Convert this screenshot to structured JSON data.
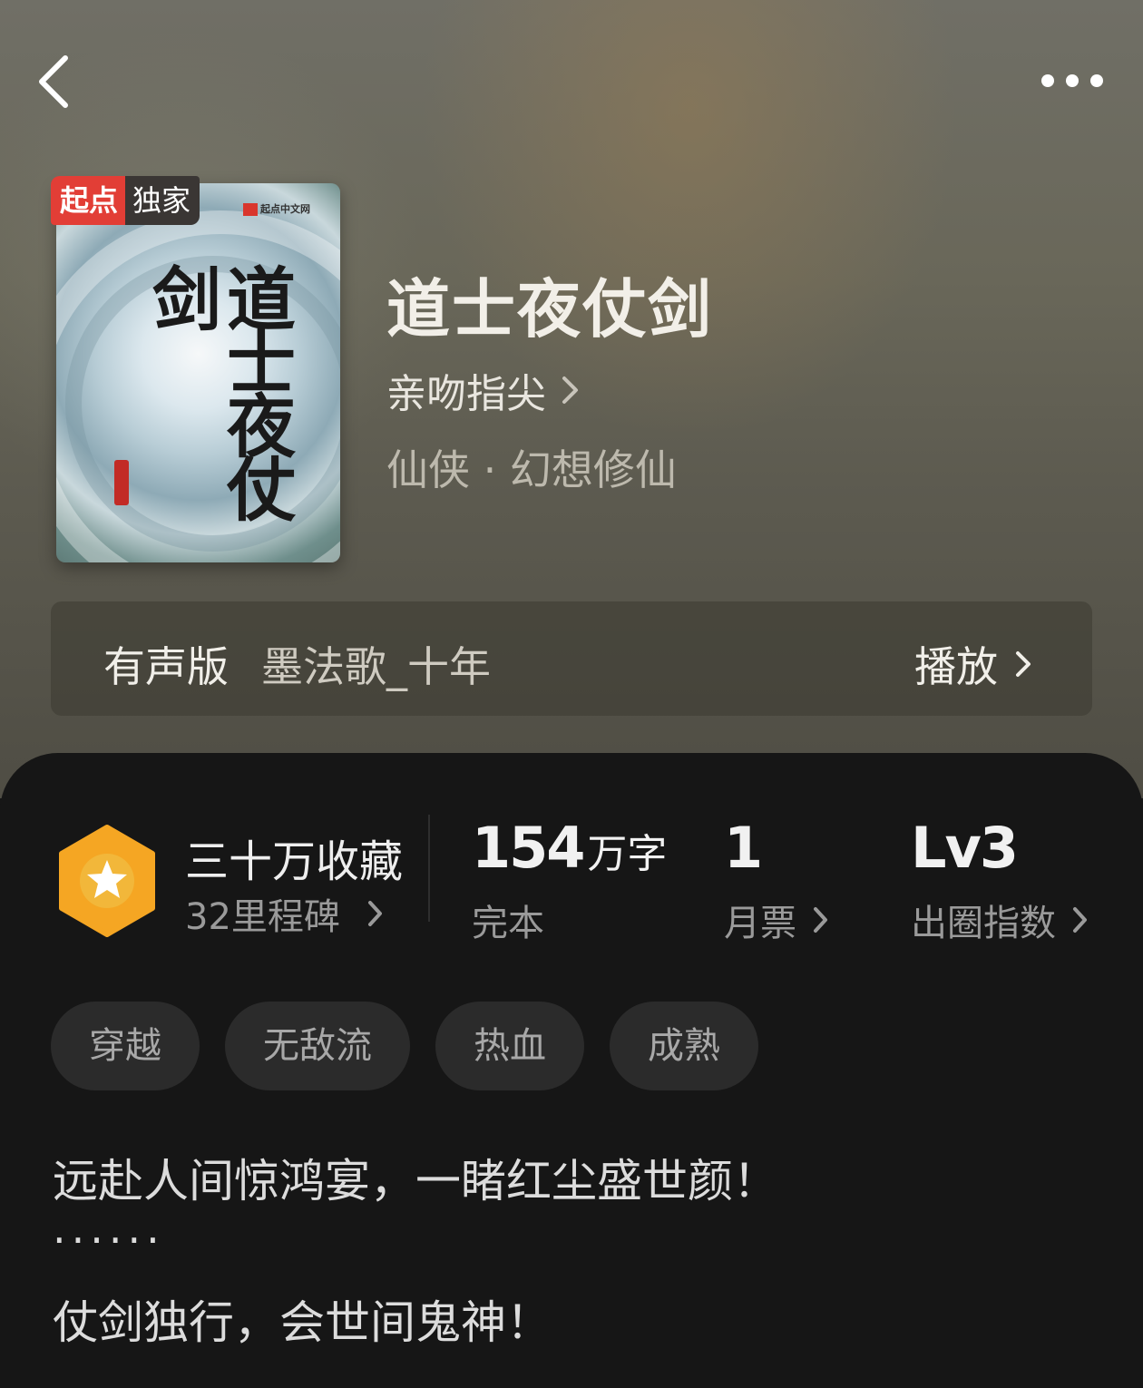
{
  "header": {
    "back_icon": "back-arrow-icon",
    "more_icon": "more-dots-icon"
  },
  "book": {
    "badge_brand": "起点",
    "badge_exclusive": "独家",
    "cover_title": "道士夜仗剑",
    "cover_publisher": "起点中文网",
    "title": "道士夜仗剑",
    "author": "亲吻指尖",
    "genre": "仙侠 · 幻想修仙"
  },
  "audio": {
    "label": "有声版",
    "narrator": "墨法歌_十年",
    "play_label": "播放"
  },
  "stats": {
    "favorites": "三十万收藏",
    "milestones": "32里程碑",
    "word_count": "154",
    "word_unit": "万字",
    "status": "完本",
    "monthly_votes": "1",
    "monthly_votes_label": "月票",
    "level": "Lv3",
    "level_label": "出圈指数"
  },
  "tags": [
    "穿越",
    "无敌流",
    "热血",
    "成熟"
  ],
  "description": {
    "line1": "远赴人间惊鸿宴，一睹红尘盛世颜！",
    "dots": "······",
    "line2": "仗剑独行，会世间鬼神！"
  },
  "colors": {
    "accent_badge": "#e23e36",
    "hex_icon": "#f5a623",
    "panel_bg": "#161616"
  }
}
